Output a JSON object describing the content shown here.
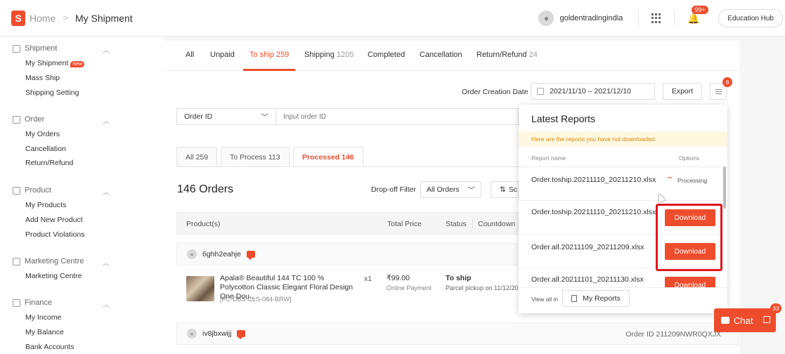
{
  "header": {
    "logo_letter": "S",
    "breadcrumb_home": "Home",
    "breadcrumb_sep": ">",
    "breadcrumb_current": "My Shipment",
    "username": "goldentradingindia",
    "notif_badge": "99+",
    "education_hub": "Education Hub"
  },
  "sidebar": {
    "shipment": {
      "title": "Shipment",
      "items": [
        "My Shipment",
        "Mass Ship",
        "Shipping Setting"
      ],
      "new_tag": "New"
    },
    "order": {
      "title": "Order",
      "items": [
        "My Orders",
        "Cancellation",
        "Return/Refund"
      ]
    },
    "product": {
      "title": "Product",
      "items": [
        "My Products",
        "Add New Product",
        "Product Violations"
      ]
    },
    "marketing": {
      "title": "Marketing Centre",
      "items": [
        "Marketing Centre"
      ]
    },
    "finance": {
      "title": "Finance",
      "items": [
        "My Income",
        "My Balance",
        "Bank Accounts"
      ]
    }
  },
  "tabs": {
    "all": "All",
    "unpaid": "Unpaid",
    "to_ship": "To ship 259",
    "shipping": "Shipping",
    "shipping_count": "1205",
    "completed": "Completed",
    "cancellation": "Cancellation",
    "return_refund": "Return/Refund",
    "return_refund_count": "24"
  },
  "filters": {
    "order_creation_date_label": "Order Creation Date",
    "date_range": "2021/11/10 – 2021/12/10",
    "export": "Export",
    "menu_badge": "8",
    "search_field": "Order ID",
    "search_placeholder": "Input order ID"
  },
  "subtabs": {
    "all": "All  259",
    "to_process": "To Process  113",
    "processed": "Processed  146"
  },
  "orders": {
    "title": "146 Orders",
    "dropoff_label": "Drop-off Filter",
    "dropoff_value": "All Orders",
    "sort_label": "Sc",
    "columns": {
      "product": "Product(s)",
      "total_price": "Total Price",
      "status": "Status",
      "countdown": "Countdown"
    },
    "list": [
      {
        "buyer": "6ghh2eahje",
        "product_name": "Apala® Beautiful 144 TC 100 % Polycotton Classic Elegant Floral Design One Dou...",
        "sku": "[PC-DBS-CLS-084-BRW]",
        "qty": "x1",
        "price": "₹99.00",
        "payment": "Online Payment",
        "status": "To ship",
        "pickup": "Parcel pickup on 11/12/20"
      },
      {
        "buyer": "iv8jbxwijj",
        "order_id": "Order ID 211209NWR0QXJX"
      }
    ]
  },
  "reports": {
    "title": "Latest Reports",
    "notice": "Here are the reports you have not downloaded.",
    "col_name": "Report name",
    "col_options": "Options",
    "rows": [
      {
        "name": "Order.toship.20211110_20211210.xlsx",
        "action": "Processing"
      },
      {
        "name": "Order.toship.20211110_20211210.xlsx",
        "action": "Download"
      },
      {
        "name": "Order.all.20211109_20211209.xlsx",
        "action": "Download"
      },
      {
        "name": "Order.all.20211101_20211130.xlsx",
        "action": "Download"
      }
    ],
    "view_all": "View all in",
    "my_reports": "My Reports"
  },
  "chat": {
    "label": "Chat",
    "badge": "33"
  },
  "colors": {
    "accent": "#ee4d2d",
    "highlight": "#e0161e",
    "notice_bg": "#fff8e1"
  }
}
